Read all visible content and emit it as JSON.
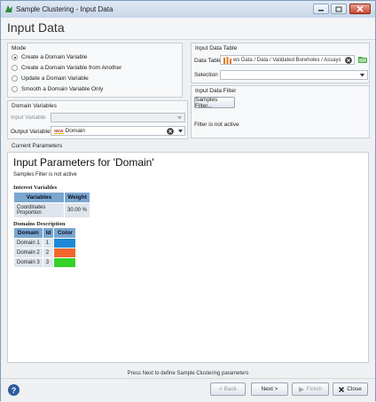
{
  "window": {
    "title": "Sample Clustering - Input Data"
  },
  "header": {
    "title": "Input Data"
  },
  "mode": {
    "title": "Mode",
    "options": [
      "Create a Domain Variable",
      "Create a Domain Variable from Another",
      "Update a Domain Variable",
      "Smooth a Domain Variable Only"
    ],
    "selected_index": 0
  },
  "input_table": {
    "title": "Input Data Table",
    "data_table_label": "Data Table",
    "data_table_value": "ws Data / Data / Validated Boreholes / Assays",
    "selection_label": "Selection",
    "selection_value": ""
  },
  "input_filter": {
    "title": "Input Data Filter",
    "button_label": "Samples Filter...",
    "status": "Filter is not active"
  },
  "domain_vars": {
    "title": "Domain Variables",
    "input_label": "Input Variable",
    "input_value": "",
    "output_label": "Output Variable",
    "output_badge": "NEW",
    "output_value": "Domain"
  },
  "current_params": {
    "title": "Current Parameters",
    "heading": "Input Parameters for 'Domain'",
    "filter_note": "Samples Filter is not active",
    "interest_title": "Interest Variables",
    "interest_headers": [
      "Variables",
      "Weight"
    ],
    "interest_rows": [
      [
        "Coordinates Proportion",
        "30.00 %"
      ]
    ],
    "domains_title": "Domains Description",
    "domains_headers": [
      "Domain",
      "Id",
      "Color"
    ],
    "domains_rows": [
      {
        "name": "Domain 1",
        "id": "1",
        "color": "#1e88d6"
      },
      {
        "name": "Domain 2",
        "id": "2",
        "color": "#f2662e"
      },
      {
        "name": "Domain 3",
        "id": "3",
        "color": "#35d12b"
      }
    ]
  },
  "footer": {
    "hint": "Press Next to define Sample Clustering parameters",
    "back": "< Back",
    "next": "Next >",
    "finish": "Finish",
    "close": "Close",
    "help_icon": "?"
  }
}
